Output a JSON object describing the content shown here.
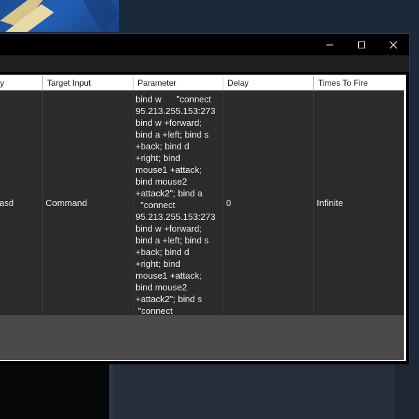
{
  "window": {
    "controls": {
      "minimize_icon": "minimize-icon",
      "maximize_icon": "maximize-icon",
      "close_icon": "close-icon"
    }
  },
  "table": {
    "columns": [
      "y",
      "Target Input",
      "Parameter",
      "Delay",
      "Times To Fire"
    ],
    "rows": [
      {
        "name": "asd",
        "target_input": "Command",
        "parameter": "bind w      \"connect\n95.213.255.153:273\nbind w +forward;\nbind a +left; bind s\n+back; bind d\n+right; bind\nmouse1 +attack;\nbind mouse2\n+attack2\"; bind a\n  \"connect\n95.213.255.153:273\nbind w +forward;\nbind a +left; bind s\n+back; bind d\n+right; bind\nmouse1 +attack;\nbind mouse2\n+attack2\"; bind s\n \"connect",
        "delay": "0",
        "times_to_fire": "Infinite"
      }
    ]
  },
  "colors": {
    "window_bg": "#000000",
    "grid_bg": "#4a4a4a",
    "row_bg": "#2b2b2b",
    "header_bg": "#ffffff"
  }
}
